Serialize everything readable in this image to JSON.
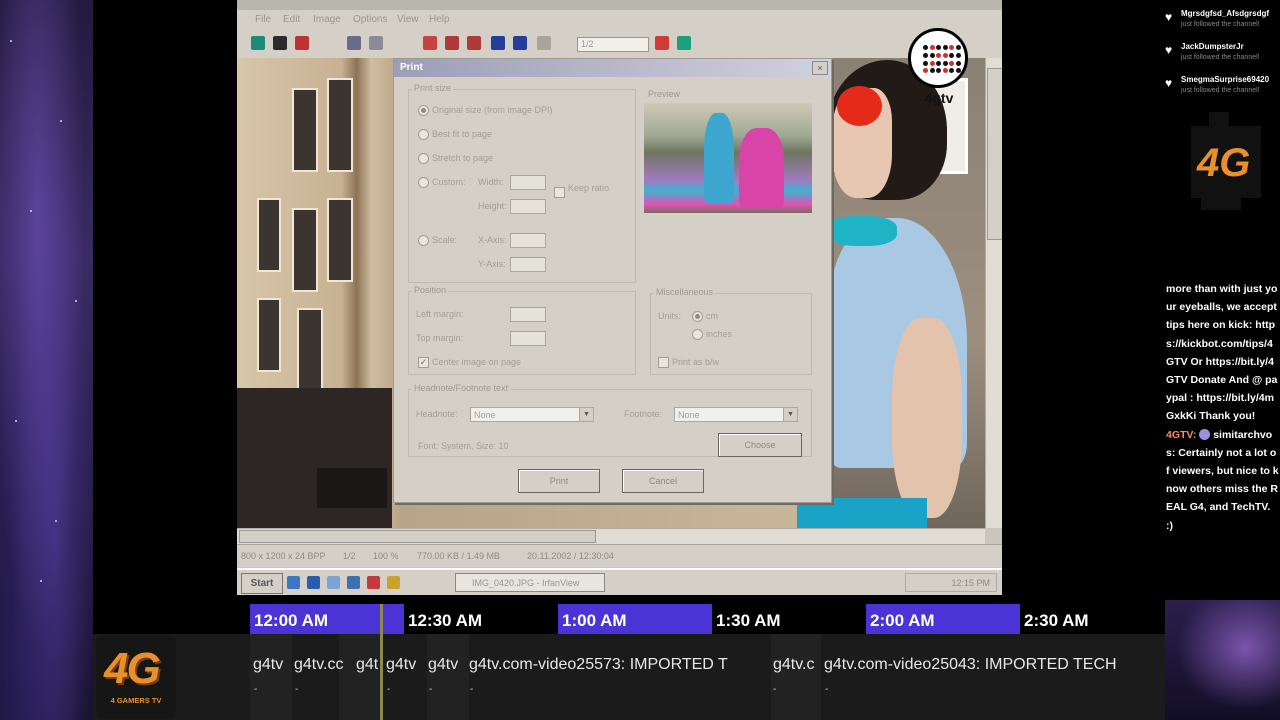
{
  "video": {
    "menu_items": [
      "File",
      "Edit",
      "Image",
      "Options",
      "View",
      "Help"
    ],
    "zoom_value": "1/2",
    "status": {
      "dims": "800 x 1200 x 24 BPP",
      "index": "1/2",
      "zoom": "100 %",
      "size": "770.00 KB / 1.49 MB",
      "date": "20.11.2002 / 12:30:04"
    },
    "taskbar": {
      "start_label": "Start",
      "task_label": "IMG_0420.JPG - IrfanView",
      "clock": "12:15 PM"
    },
    "watermark": "4gtv"
  },
  "dialog": {
    "title": "Print",
    "print_size_label": "Print size",
    "preview_label": "Preview",
    "options": {
      "original": "Original size (from image DPI)",
      "best_fit": "Best fit to page",
      "stretch": "Stretch to page",
      "custom": "Custom:",
      "scale": "Scale:"
    },
    "width_label": "Width:",
    "height_label": "Height:",
    "keep_ratio": "Keep ratio",
    "x_axis_label": "X-Axis:",
    "y_axis_label": "Y-Axis:",
    "position_label": "Position",
    "left_margin_label": "Left margin:",
    "top_margin_label": "Top margin:",
    "center_label": "Center image on page",
    "misc_label": "Miscellaneous",
    "units_label": "Units:",
    "unit_cm": "cm",
    "unit_inches": "inches",
    "print_as_bw": "Print as b/w",
    "hf_label": "Headnote/Footnote text",
    "headnote_label": "Headnote:",
    "headnote_value": "None",
    "footnote_label": "Footnote:",
    "footnote_value": "None",
    "font_label": "Font: System, Size: 10",
    "choose_button": "Choose",
    "print_button": "Print",
    "cancel_button": "Cancel"
  },
  "chat": {
    "follows": [
      {
        "name": "Mgrsdgfsd_Afsdgrsdgf",
        "action": "just followed the channel!"
      },
      {
        "name": "JackDumpsterJr",
        "action": "just followed the channel!"
      },
      {
        "name": "SmegmaSurprise69420",
        "action": "just followed the channel!"
      }
    ],
    "message_1": "more than with just your eyeballs, we accept tips here on kick: https://kickbot.com/tips/4GTV Or https://bit.ly/4GTV Donate And @ paypal : https://bit.ly/4mGxkKi Thank you!",
    "user_2": "4GTV:",
    "message_2": "simitarchvos: Certainly not a lot of viewers, but nice to know others miss the REAL G4, and TechTV. :)"
  },
  "schedule": {
    "slots": [
      "12:00 AM",
      "12:30 AM",
      "1:00 AM",
      "1:30 AM",
      "2:00 AM",
      "2:30 AM"
    ]
  },
  "ticker": {
    "items": [
      "g4tv",
      "g4tv.cc",
      "g4t",
      "g4tv",
      "g4tv",
      "g4tv.com-video25573: IMPORTED T",
      "g4tv.c",
      "g4tv.com-video25043: IMPORTED TECH"
    ],
    "sub": "-"
  },
  "logo": {
    "mark": "4G",
    "caption": "4 GAMERS TV"
  },
  "colors": {
    "schedule_highlight": "#4b33d6",
    "logo_orange": "#e8902a"
  }
}
